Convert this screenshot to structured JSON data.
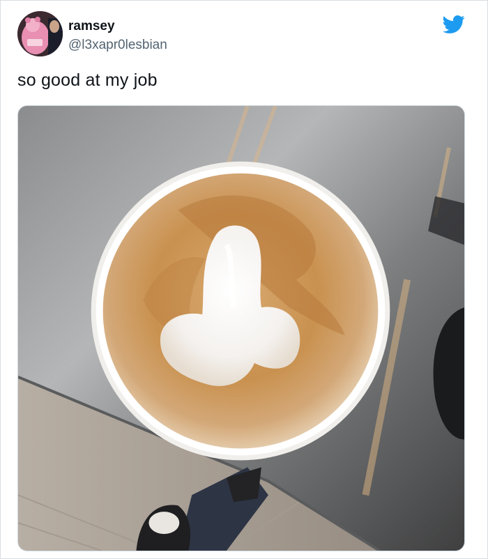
{
  "author": {
    "display_name": "ramsey",
    "handle": "@l3xapr0lesbian",
    "avatar_icon": "profile-avatar"
  },
  "brand": {
    "icon": "twitter-bird-icon",
    "color": "#1d9bf0"
  },
  "tweet": {
    "text": "so good at my job"
  },
  "media": {
    "icon": "latte-art-photo"
  }
}
